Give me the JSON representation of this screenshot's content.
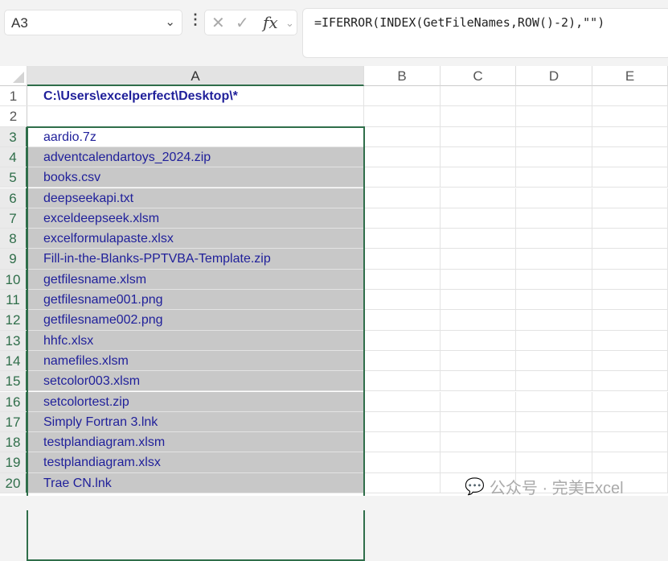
{
  "name_box": {
    "value": "A3"
  },
  "formula_bar": {
    "cancel_icon": "x-icon",
    "enter_icon": "check-icon",
    "fx_label": "fx",
    "formula": "=IFERROR(INDEX(GetFileNames,ROW()-2),\"\")"
  },
  "columns": [
    "A",
    "B",
    "C",
    "D",
    "E"
  ],
  "rows": [
    {
      "n": "1",
      "a": "C:\\Users\\excelperfect\\Desktop\\*"
    },
    {
      "n": "2",
      "a": ""
    },
    {
      "n": "3",
      "a": "aardio.7z"
    },
    {
      "n": "4",
      "a": "adventcalendartoys_2024.zip"
    },
    {
      "n": "5",
      "a": "books.csv"
    },
    {
      "n": "6",
      "a": "deepseekapi.txt"
    },
    {
      "n": "7",
      "a": "exceldeepseek.xlsm"
    },
    {
      "n": "8",
      "a": "excelformulapaste.xlsx"
    },
    {
      "n": "9",
      "a": "Fill-in-the-Blanks-PPTVBA-Template.zip"
    },
    {
      "n": "10",
      "a": "getfilesname.xlsm"
    },
    {
      "n": "11",
      "a": "getfilesname001.png"
    },
    {
      "n": "12",
      "a": "getfilesname002.png"
    },
    {
      "n": "13",
      "a": "hhfc.xlsx"
    },
    {
      "n": "14",
      "a": "namefiles.xlsm"
    },
    {
      "n": "15",
      "a": "setcolor003.xlsm"
    },
    {
      "n": "16",
      "a": "setcolortest.zip"
    },
    {
      "n": "17",
      "a": "Simply Fortran 3.lnk"
    },
    {
      "n": "18",
      "a": "testplandiagram.xlsm"
    },
    {
      "n": "19",
      "a": "testplandiagram.xlsx"
    },
    {
      "n": "20",
      "a": "Trae CN.lnk"
    }
  ],
  "watermark": "公众号 · 完美Excel"
}
